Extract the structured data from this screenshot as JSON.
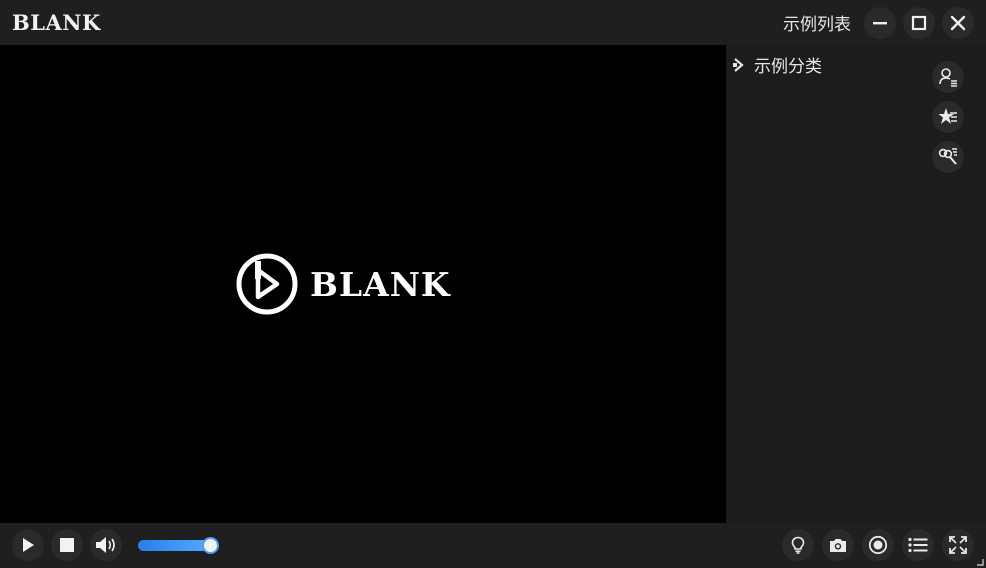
{
  "app": {
    "brand": "BLANK"
  },
  "titlebar": {
    "list_label": "示例列表",
    "buttons": {
      "minimize": "minimize-icon",
      "maximize": "maximize-icon",
      "close": "close-icon"
    }
  },
  "player": {
    "logo_text": "BLANK"
  },
  "sidebar": {
    "category_label": "示例分类",
    "tools": [
      "user-list-icon",
      "starred-list-icon",
      "search-list-icon"
    ]
  },
  "controls": {
    "buttons": [
      "play-icon",
      "stop-icon",
      "volume-icon",
      "light-bulb-icon",
      "camera-icon",
      "record-icon",
      "playlist-icon",
      "fullscreen-icon"
    ],
    "volume_level": 0.9
  },
  "colors": {
    "accent": "#4a9bff",
    "background": "#1e1e1e",
    "video_bg": "#000000"
  }
}
